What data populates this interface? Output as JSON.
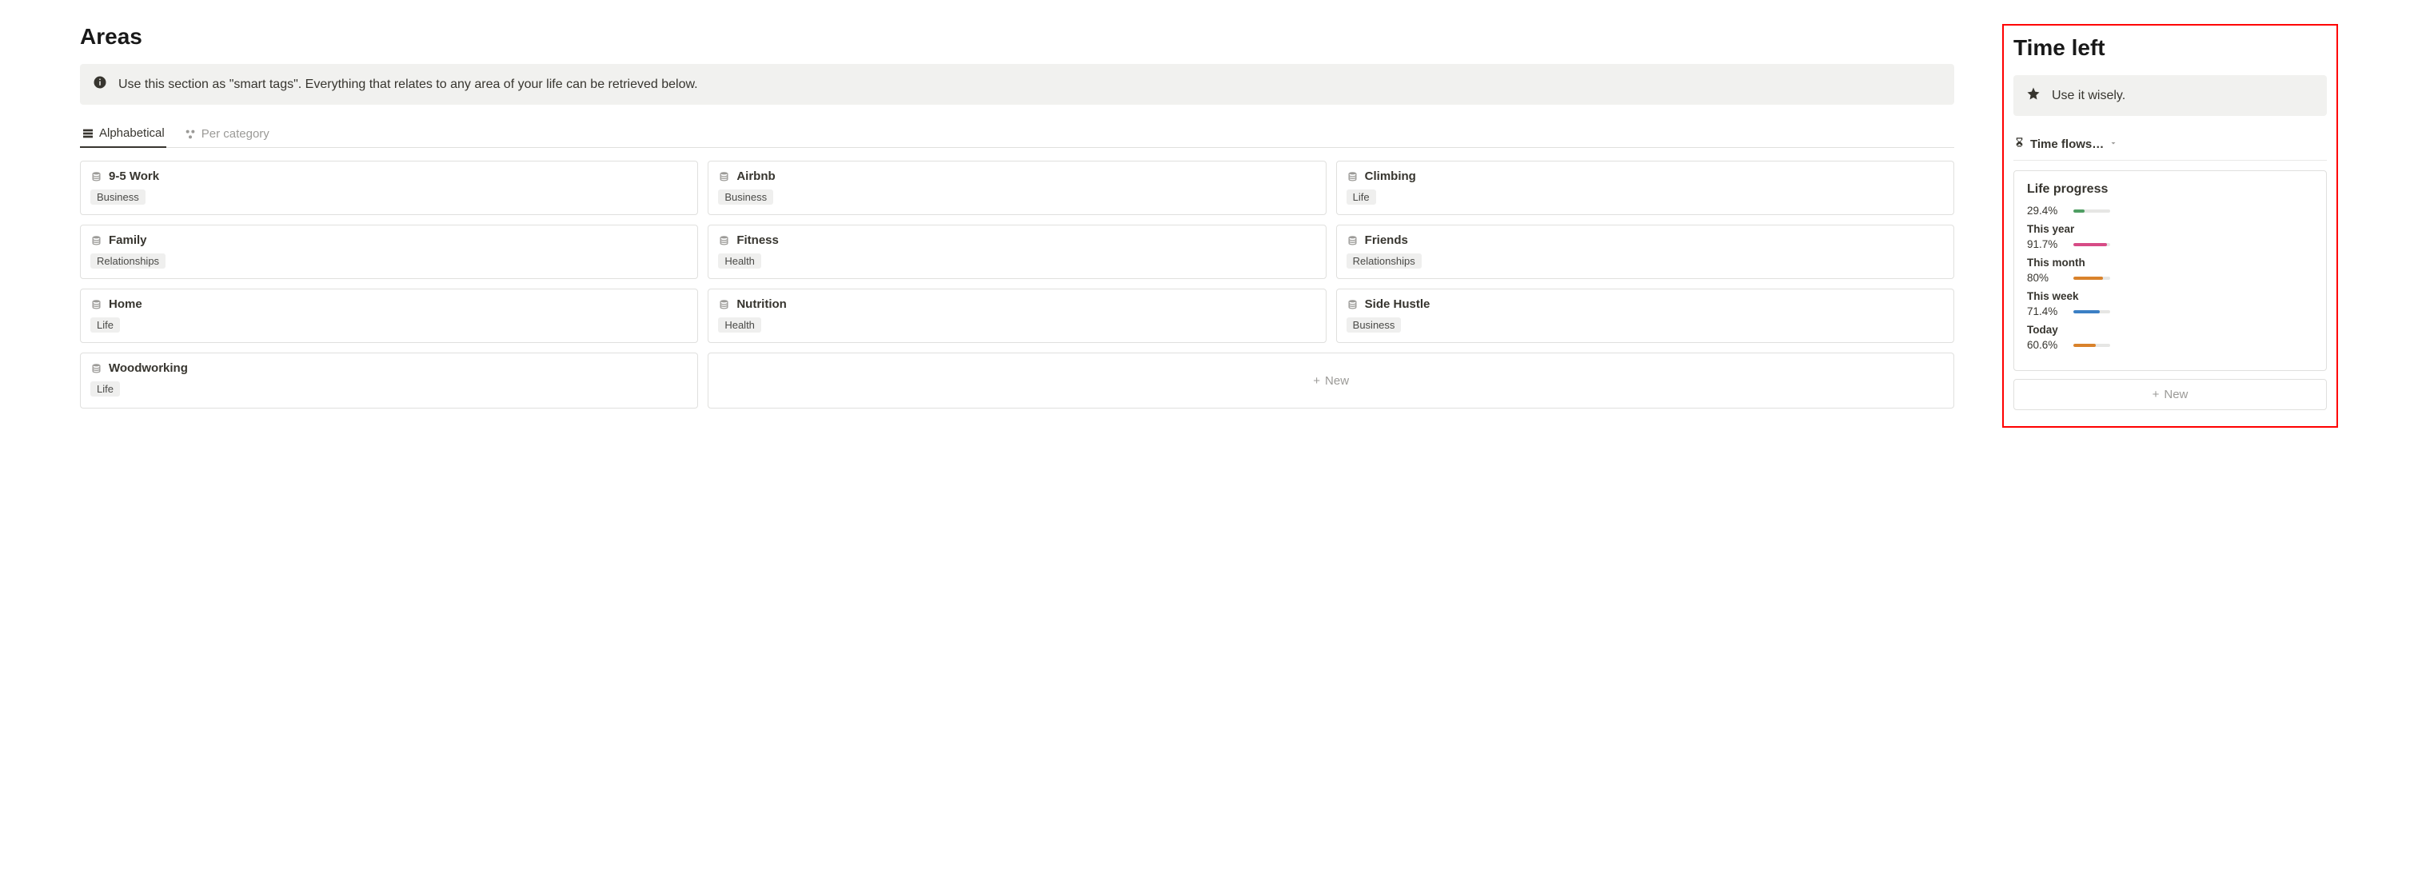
{
  "areas": {
    "title": "Areas",
    "callout": "Use this section as \"smart tags\". Everything that relates to any area of your life can be retrieved below.",
    "tabs": [
      {
        "label": "Alphabetical",
        "active": true
      },
      {
        "label": "Per category",
        "active": false
      }
    ],
    "cards": [
      {
        "title": "9-5 Work",
        "tag": "Business"
      },
      {
        "title": "Airbnb",
        "tag": "Business"
      },
      {
        "title": "Climbing",
        "tag": "Life"
      },
      {
        "title": "Family",
        "tag": "Relationships"
      },
      {
        "title": "Fitness",
        "tag": "Health"
      },
      {
        "title": "Friends",
        "tag": "Relationships"
      },
      {
        "title": "Home",
        "tag": "Life"
      },
      {
        "title": "Nutrition",
        "tag": "Health"
      },
      {
        "title": "Side Hustle",
        "tag": "Business"
      },
      {
        "title": "Woodworking",
        "tag": "Life"
      }
    ],
    "new_label": "New"
  },
  "timeleft": {
    "title": "Time left",
    "callout": "Use it wisely.",
    "toggle_label": "Time flows…",
    "card_title": "Life progress",
    "rows": [
      {
        "label": "",
        "pct": "29.4%",
        "value": 29.4,
        "color": "#4f9e63"
      },
      {
        "label": "This year",
        "pct": "91.7%",
        "value": 91.7,
        "color": "#d74b86"
      },
      {
        "label": "This month",
        "pct": "80%",
        "value": 80,
        "color": "#d9822b"
      },
      {
        "label": "This week",
        "pct": "71.4%",
        "value": 71.4,
        "color": "#3b7fc4"
      },
      {
        "label": "Today",
        "pct": "60.6%",
        "value": 60.6,
        "color": "#d9822b"
      }
    ],
    "new_label": "New"
  }
}
